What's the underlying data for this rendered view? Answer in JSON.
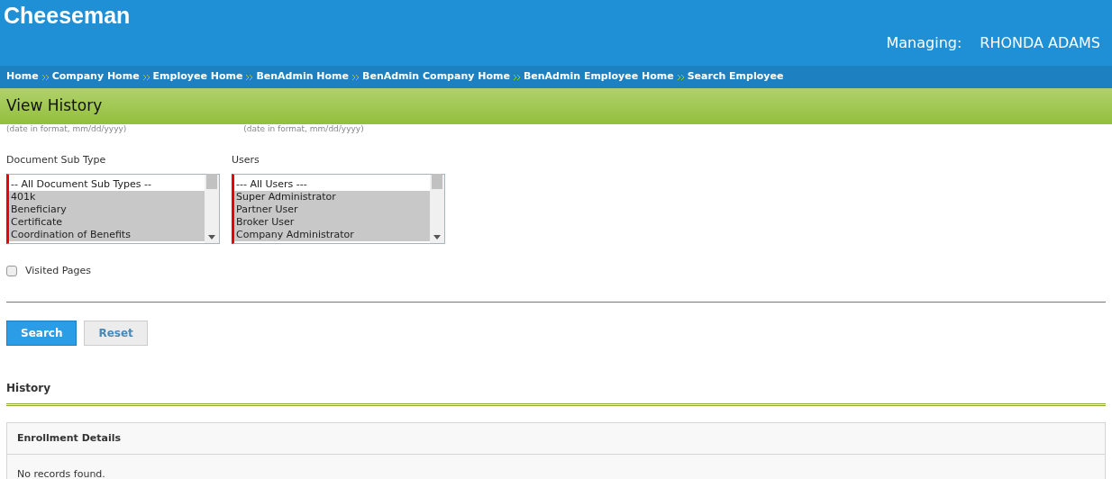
{
  "brand": "Cheeseman",
  "managing": {
    "label": "Managing:",
    "name": "RHONDA ADAMS"
  },
  "breadcrumbs": [
    "Home",
    "Company Home",
    "Employee Home",
    "BenAdmin Home",
    "BenAdmin Company Home",
    "BenAdmin Employee Home",
    "Search Employee"
  ],
  "page_title": "View History",
  "date_hints": [
    "(date in format, mm/dd/yyyy)",
    "(date in format, mm/dd/yyyy)"
  ],
  "lists": [
    {
      "label": "Document Sub Type",
      "options": [
        {
          "text": "-- All Document Sub Types --",
          "selected": false
        },
        {
          "text": "401k",
          "selected": true
        },
        {
          "text": "Beneficiary",
          "selected": true
        },
        {
          "text": "Certificate",
          "selected": true
        },
        {
          "text": "Coordination of Benefits",
          "selected": true
        }
      ]
    },
    {
      "label": "Users",
      "options": [
        {
          "text": "--- All Users ---",
          "selected": false
        },
        {
          "text": "Super Administrator",
          "selected": true
        },
        {
          "text": "Partner User",
          "selected": true
        },
        {
          "text": "Broker User",
          "selected": true
        },
        {
          "text": "Company Administrator",
          "selected": true
        }
      ]
    }
  ],
  "visited_pages": {
    "label": "Visited Pages",
    "checked": false
  },
  "buttons": [
    {
      "label": "Search",
      "kind": "primary"
    },
    {
      "label": "Reset",
      "kind": "secondary"
    }
  ],
  "history": {
    "title": "History",
    "panel_title": "Enrollment Details",
    "empty_text": "No records found."
  }
}
